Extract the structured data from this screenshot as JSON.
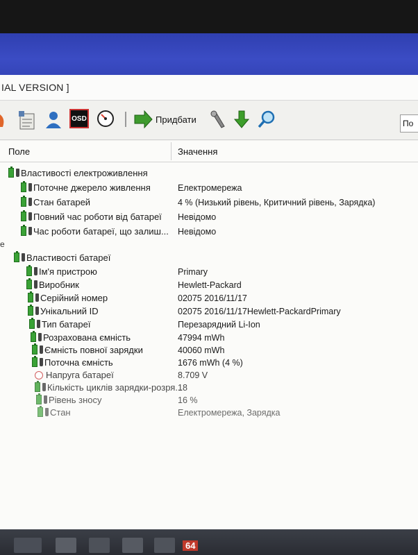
{
  "window": {
    "title": "IAL VERSION ]"
  },
  "toolbar": {
    "add_label": "Придбати",
    "search_value": "По",
    "osd_label": "OSD"
  },
  "columns": {
    "field": "Поле",
    "value": "Значення"
  },
  "power": {
    "group": "Властивості електроживлення",
    "rows": [
      {
        "field": "Поточне джерело живлення",
        "value": "Електромережа"
      },
      {
        "field": "Стан батарей",
        "value": "4 % (Низький рівень, Критичний рівень, Зарядка)"
      },
      {
        "field": "Повний час роботи від батареї",
        "value": "Невідомо"
      },
      {
        "field": "Час роботи батареї, що залиш...",
        "value": "Невідомо"
      }
    ]
  },
  "collapse_mark": "e",
  "battery": {
    "group": "Властивості батареї",
    "rows": [
      {
        "field": "Ім'я пристрою",
        "value": "Primary"
      },
      {
        "field": "Виробник",
        "value": "Hewlett-Packard"
      },
      {
        "field": "Серійний номер",
        "value": "02075 2016/11/17"
      },
      {
        "field": "Унікальний ID",
        "value": "02075 2016/11/17Hewlett-PackardPrimary"
      },
      {
        "field": "Тип батареї",
        "value": "Перезарядний Li-Ion"
      },
      {
        "field": "Розрахована ємність",
        "value": "47994 mWh"
      },
      {
        "field": "Ємність повної зарядки",
        "value": "40060 mWh"
      },
      {
        "field": "Поточна ємність",
        "value": "1676 mWh  (4 %)"
      },
      {
        "field": "Напруга батареї",
        "value": "8.709 V"
      },
      {
        "field": "Кількість циклів зарядки-розря...",
        "value": "18"
      },
      {
        "field": "Рівень зносу",
        "value": "16 %"
      },
      {
        "field": "Стан",
        "value": "Електромережа, Зарядка"
      }
    ]
  },
  "taskbar": {
    "badge": "64"
  }
}
